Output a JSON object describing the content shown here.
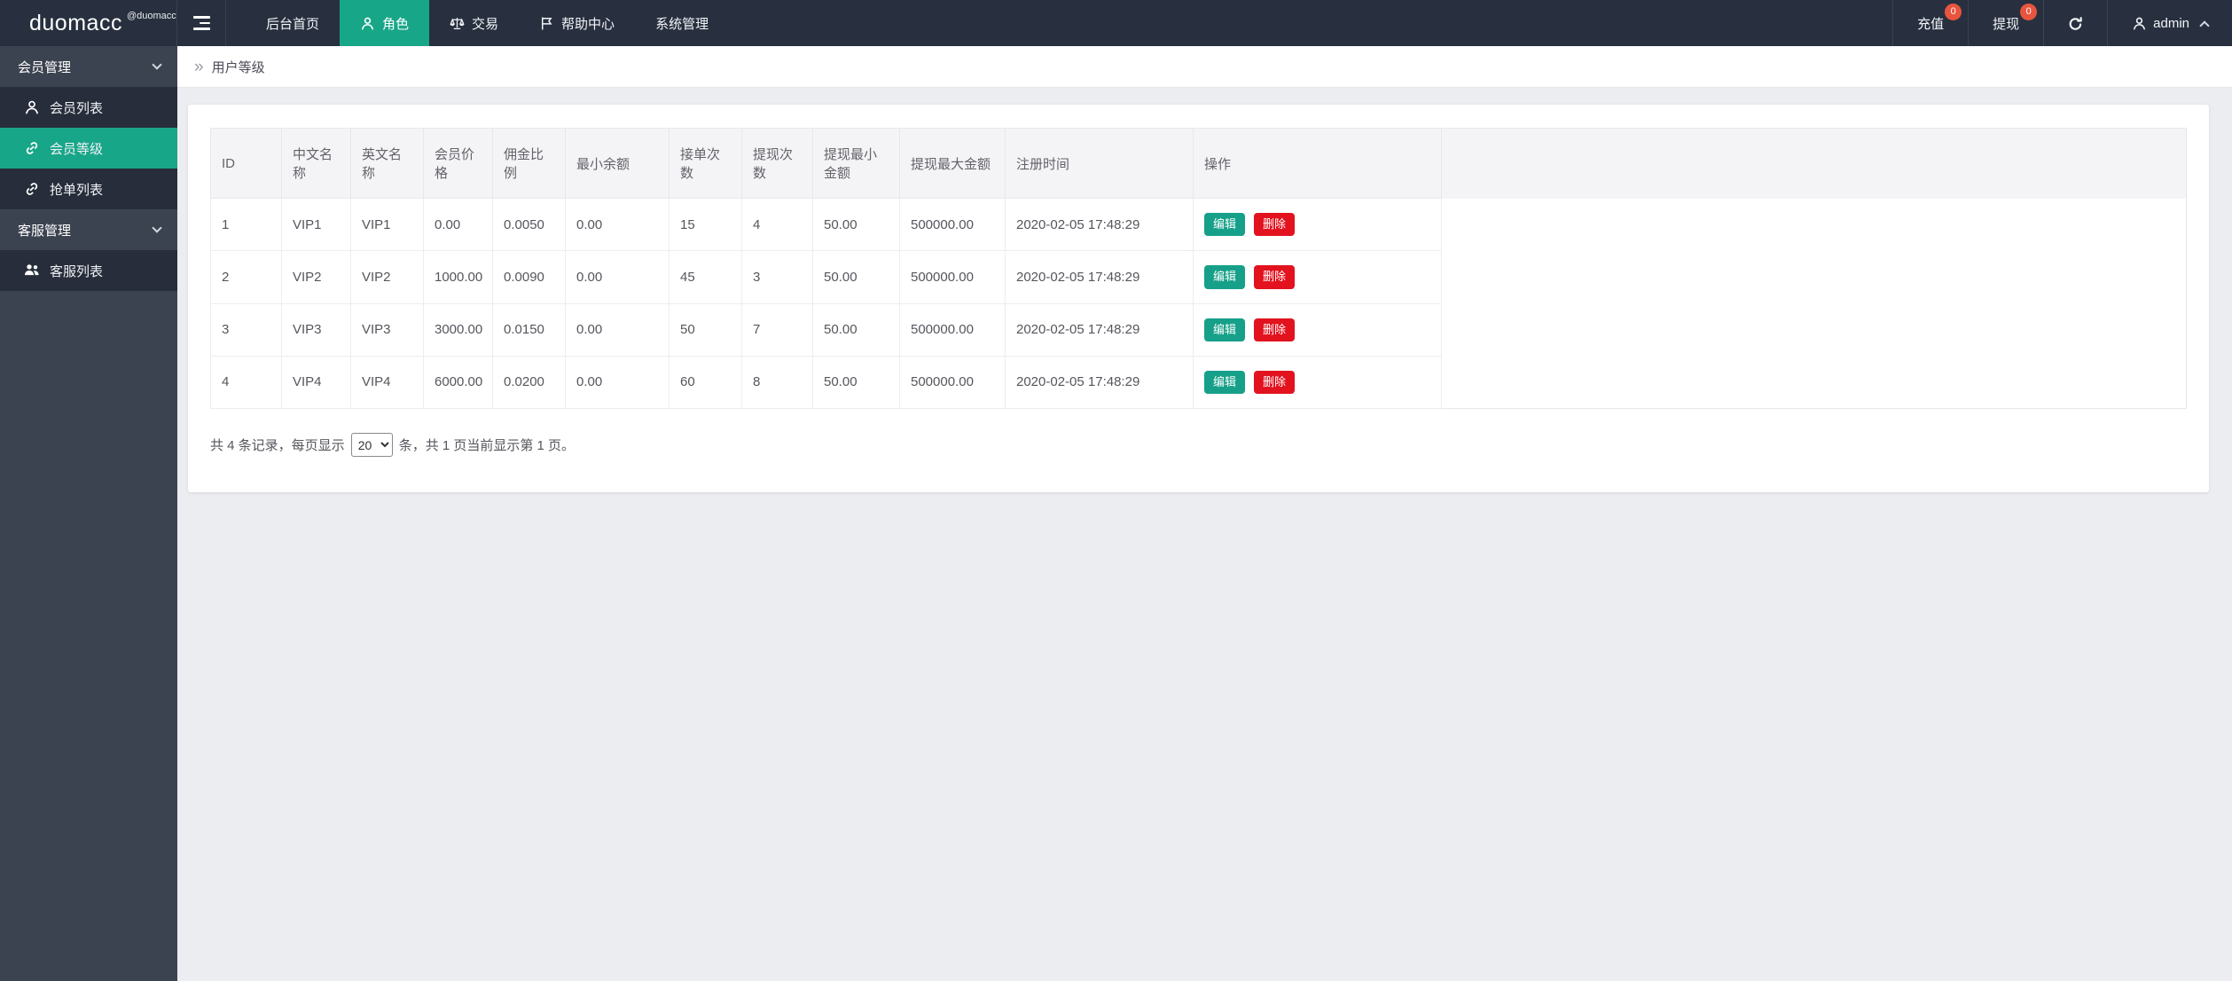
{
  "navbar": {
    "brand": "duomacc",
    "brand_suffix": "@duomacc",
    "items": [
      {
        "label": "后台首页",
        "active": false
      },
      {
        "label": "角色",
        "active": true
      },
      {
        "label": "交易",
        "active": false
      },
      {
        "label": "帮助中心",
        "active": false
      },
      {
        "label": "系统管理",
        "active": false
      }
    ],
    "recharge": {
      "label": "充值",
      "badge": "0"
    },
    "withdraw": {
      "label": "提现",
      "badge": "0"
    },
    "user": {
      "name": "admin"
    }
  },
  "sidebar": {
    "groups": [
      {
        "label": "会员管理",
        "items": [
          {
            "label": "会员列表",
            "active": false
          },
          {
            "label": "会员等级",
            "active": true
          },
          {
            "label": "抢单列表",
            "active": false
          }
        ]
      },
      {
        "label": "客服管理",
        "items": [
          {
            "label": "客服列表",
            "active": false
          }
        ]
      }
    ]
  },
  "breadcrumb": {
    "title": "用户等级"
  },
  "table": {
    "columns": [
      "ID",
      "中文名称",
      "英文名称",
      "会员价格",
      "佣金比例",
      "最小余额",
      "接单次数",
      "提现次数",
      "提现最小金额",
      "提现最大金额",
      "注册时间",
      "操作"
    ],
    "rows": [
      [
        "1",
        "VIP1",
        "VIP1",
        "0.00",
        "0.0050",
        "0.00",
        "15",
        "4",
        "50.00",
        "500000.00",
        "2020-02-05 17:48:29"
      ],
      [
        "2",
        "VIP2",
        "VIP2",
        "1000.00",
        "0.0090",
        "0.00",
        "45",
        "3",
        "50.00",
        "500000.00",
        "2020-02-05 17:48:29"
      ],
      [
        "3",
        "VIP3",
        "VIP3",
        "3000.00",
        "0.0150",
        "0.00",
        "50",
        "7",
        "50.00",
        "500000.00",
        "2020-02-05 17:48:29"
      ],
      [
        "4",
        "VIP4",
        "VIP4",
        "6000.00",
        "0.0200",
        "0.00",
        "60",
        "8",
        "50.00",
        "500000.00",
        "2020-02-05 17:48:29"
      ]
    ],
    "actions": {
      "edit": "编辑",
      "delete": "删除"
    }
  },
  "pagination": {
    "prefix": "共 4 条记录，每页显示",
    "per_page": "20",
    "suffix": "条，共 1 页当前显示第 1 页。"
  },
  "colors": {
    "accent": "#18a689",
    "edit_button": "#16a089",
    "delete_button": "#e2131f",
    "badge": "#e8543e",
    "navbar_bg": "#28303f",
    "sidebar_bg": "#3c4350",
    "sidebar_item_bg": "#272d3a"
  }
}
